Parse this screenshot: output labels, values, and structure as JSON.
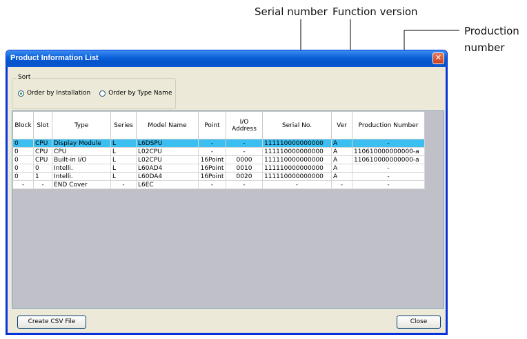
{
  "annotations": {
    "serial_number": "Serial number",
    "function_version": "Function version",
    "production_number_line1": "Production",
    "production_number_line2": "number"
  },
  "window": {
    "title": "Product Information List",
    "close_glyph": "✕"
  },
  "sort": {
    "legend": "Sort",
    "options": [
      {
        "label": "Order by Installation",
        "selected": true
      },
      {
        "label": "Order by Type Name",
        "selected": false
      }
    ]
  },
  "table": {
    "headers": [
      "Block",
      "Slot",
      "Type",
      "Series",
      "Model Name",
      "Point",
      "I/O Address",
      "Serial No.",
      "Ver",
      "Production Number"
    ],
    "rows": [
      [
        "0",
        "CPU",
        "Display Module",
        "L",
        "L6DSPU",
        "-",
        "-",
        "111110000000000",
        "A",
        "-"
      ],
      [
        "0",
        "CPU",
        "CPU",
        "L",
        "L02CPU",
        "-",
        "-",
        "111110000000000",
        "A",
        "110610000000000-a"
      ],
      [
        "0",
        "CPU",
        "Built-in I/O",
        "L",
        "L02CPU",
        "16Point",
        "0000",
        "111110000000000",
        "A",
        "110610000000000-a"
      ],
      [
        "0",
        "0",
        "Intelli.",
        "L",
        "L60AD4",
        "16Point",
        "0010",
        "111110000000000",
        "A",
        "-"
      ],
      [
        "0",
        "1",
        "Intelli.",
        "L",
        "L60DA4",
        "16Point",
        "0020",
        "111110000000000",
        "A",
        "-"
      ],
      [
        "-",
        "-",
        "END Cover",
        "-",
        "L6EC",
        "-",
        "-",
        "-",
        "-",
        "-"
      ]
    ],
    "selected_row": 0
  },
  "buttons": {
    "create_csv": "Create CSV File",
    "close": "Close"
  },
  "colors": {
    "titlebar": "#0a5fd8",
    "selection": "#3bbef0",
    "grid_background": "#c0c0c8",
    "dialog_face": "#ece9d8"
  }
}
